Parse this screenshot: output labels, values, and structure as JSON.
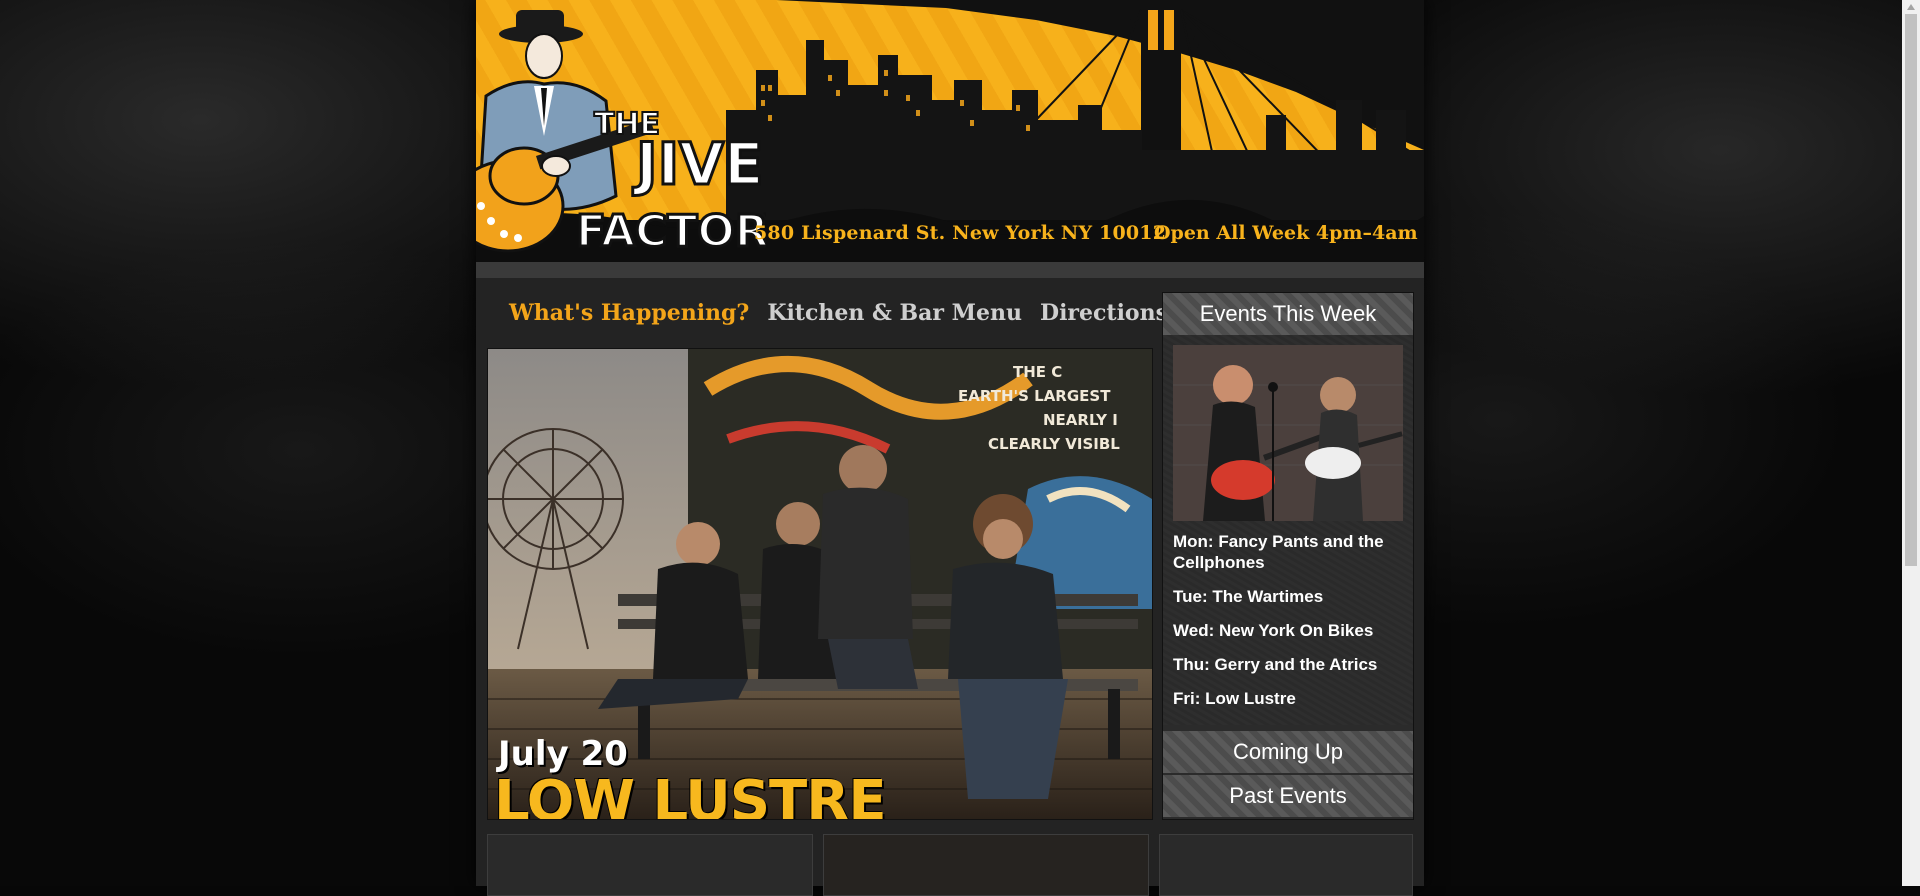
{
  "header": {
    "logo_text": "THE JIVE FACTORY",
    "address": "580 Lispenard St. New York NY 10012",
    "hours": "Open All Week 4pm–4am"
  },
  "nav": {
    "items": [
      {
        "label": "What's Happening?",
        "active": true
      },
      {
        "label": "Kitchen & Bar Menu",
        "active": false
      },
      {
        "label": "Directions",
        "active": false
      }
    ]
  },
  "hero": {
    "date": "July 20",
    "band": "LOW LUSTRE",
    "mural_text": [
      "THE C",
      "EARTH'S LARGEST",
      "NEARLY I",
      "CLEARLY VISIBL"
    ]
  },
  "sidebar": {
    "events_title": "Events This Week",
    "events": [
      "Mon: Fancy Pants and the Cellphones",
      "Tue: The Wartimes",
      "Wed: New York On Bikes",
      "Thu: Gerry and the Atrics",
      "Fri: Low Lustre"
    ],
    "coming_up_label": "Coming Up",
    "past_events_label": "Past Events"
  },
  "colors": {
    "accent": "#f3a51a",
    "nav_inactive": "#cfcfcf",
    "page_bg": "#202020"
  }
}
